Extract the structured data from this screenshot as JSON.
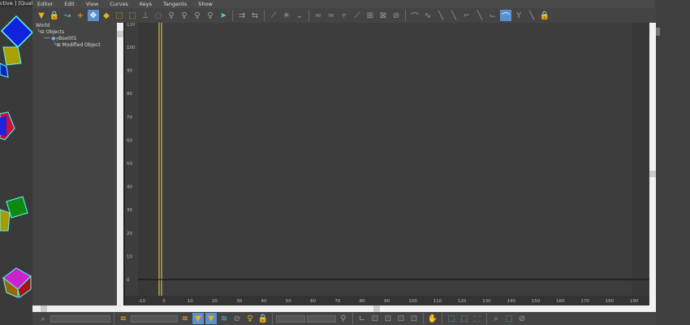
{
  "viewport": {
    "label": "ctive ] [Quality"
  },
  "menu": [
    "Editor",
    "Edit",
    "View",
    "Curves",
    "Keys",
    "Tangents",
    "Show"
  ],
  "tree": {
    "world": "World",
    "objects": "Objects",
    "box": "Box001",
    "modified": "Modified Object"
  },
  "graph": {
    "y_ticks": [
      "110",
      "100",
      "90",
      "80",
      "70",
      "60",
      "50",
      "40",
      "30",
      "20",
      "10",
      "0"
    ],
    "x_ticks": [
      "-10",
      "0",
      "10",
      "20",
      "30",
      "40",
      "50",
      "60",
      "70",
      "80",
      "90",
      "100",
      "110",
      "120",
      "130",
      "140",
      "150",
      "160",
      "170",
      "180",
      "190"
    ],
    "colors": {
      "frame_line": "#b8a640",
      "bg": "#3d3d3d",
      "zero_line": "#111111"
    }
  }
}
